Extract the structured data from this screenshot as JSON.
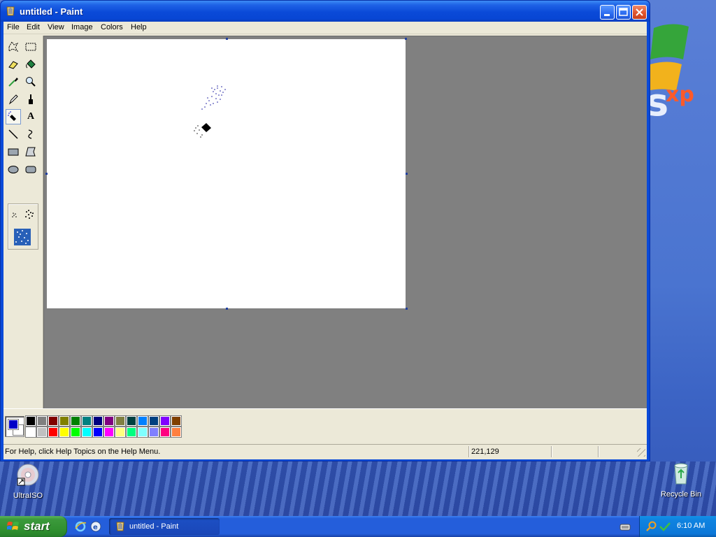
{
  "window": {
    "title": "untitled - Paint",
    "menu": [
      "File",
      "Edit",
      "View",
      "Image",
      "Colors",
      "Help"
    ]
  },
  "tools": [
    {
      "name": "free-form-select",
      "icon": "free-form-select-icon"
    },
    {
      "name": "select",
      "icon": "select-icon"
    },
    {
      "name": "eraser",
      "icon": "eraser-icon"
    },
    {
      "name": "fill-with-color",
      "icon": "fill-bucket-icon"
    },
    {
      "name": "pick-color",
      "icon": "eyedropper-icon"
    },
    {
      "name": "magnifier",
      "icon": "magnifier-icon"
    },
    {
      "name": "pencil",
      "icon": "pencil-icon"
    },
    {
      "name": "brush",
      "icon": "brush-icon"
    },
    {
      "name": "airbrush",
      "icon": "airbrush-icon",
      "selected": true
    },
    {
      "name": "text",
      "icon": "text-icon",
      "glyph": "A"
    },
    {
      "name": "line",
      "icon": "line-icon"
    },
    {
      "name": "curve",
      "icon": "curve-icon"
    },
    {
      "name": "rectangle",
      "icon": "rectangle-icon"
    },
    {
      "name": "polygon",
      "icon": "polygon-icon"
    },
    {
      "name": "ellipse",
      "icon": "ellipse-icon"
    },
    {
      "name": "rounded-rectangle",
      "icon": "rounded-rectangle-icon"
    }
  ],
  "colors": {
    "foreground": "#0000c8",
    "background": "#ffffff",
    "palette_top": [
      "#000000",
      "#808080",
      "#800000",
      "#808000",
      "#008000",
      "#008080",
      "#000080",
      "#800080",
      "#808040",
      "#004040",
      "#0080ff",
      "#004080",
      "#8000ff",
      "#804000"
    ],
    "palette_bottom": [
      "#ffffff",
      "#c0c0c0",
      "#ff0000",
      "#ffff00",
      "#00ff00",
      "#00ffff",
      "#0000ff",
      "#ff00ff",
      "#ffff80",
      "#00ff80",
      "#80ffff",
      "#8080ff",
      "#ff0080",
      "#ff8040"
    ]
  },
  "status": {
    "help_text": "For Help, click Help Topics on the Help Menu.",
    "coords": "221,129"
  },
  "desktop": {
    "icons": [
      {
        "label": "UltraISO",
        "icon": "ultraiso-icon"
      },
      {
        "label": "Recycle Bin",
        "icon": "recycle-bin-icon"
      }
    ]
  },
  "taskbar": {
    "start_label": "start",
    "task_label": "untitled - Paint",
    "clock": "6:10 AM"
  }
}
